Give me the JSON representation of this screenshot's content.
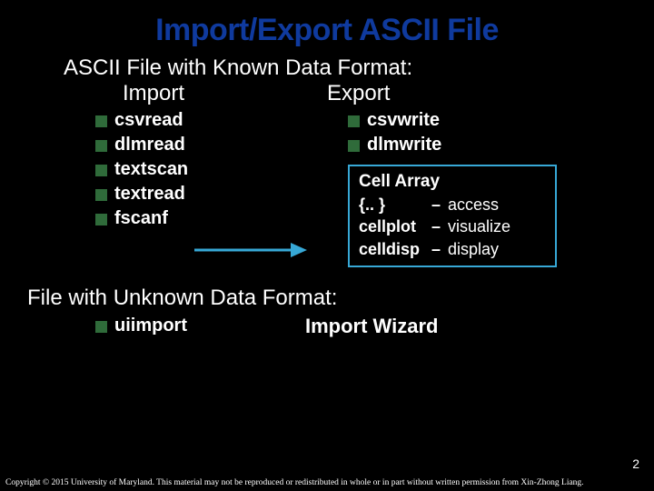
{
  "title": "Import/Export ASCII File",
  "section1": {
    "heading": "ASCII File with Known Data Format:",
    "importLabel": "Import",
    "exportLabel": "Export",
    "importItems": [
      "csvread",
      "dlmread",
      "textscan",
      "textread",
      "fscanf"
    ],
    "exportItems": [
      "csvwrite",
      "dlmwrite"
    ],
    "box": {
      "header": "Cell Array",
      "rows": [
        {
          "k": "{.. }",
          "v": "access"
        },
        {
          "k": "cellplot",
          "v": "visualize"
        },
        {
          "k": "celldisp",
          "v": "display"
        }
      ]
    }
  },
  "section2": {
    "heading": "File with Unknown Data Format:",
    "item": "uiimport",
    "wizard": "Import Wizard"
  },
  "page": "2",
  "copyright": "Copyright © 2015 University of Maryland. This material may not be reproduced or redistributed in whole or in part without written permission from Xin-Zhong Liang."
}
